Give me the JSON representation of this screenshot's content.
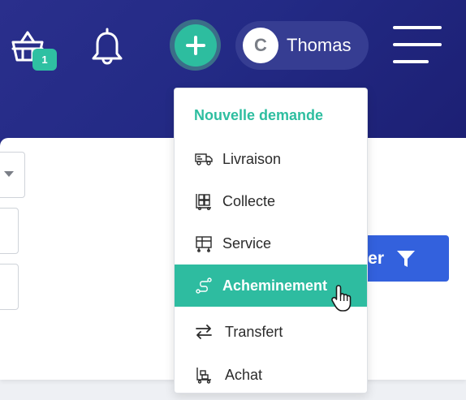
{
  "header": {
    "cart": {
      "icon": "shopping-basket-icon",
      "badge": "1",
      "badge_color": "#2fc0a2"
    },
    "notifications": {
      "icon": "bell-icon"
    },
    "new_request_button": {
      "icon": "plus-icon",
      "color": "#2dbd9f"
    },
    "user": {
      "initial": "C",
      "name": "Thomas"
    },
    "menu": {
      "icon": "hamburger-menu-icon"
    }
  },
  "filters": {
    "filter_button": {
      "label": "trer",
      "icon": "funnel-icon",
      "color": "#3361dd"
    }
  },
  "dropdown": {
    "title": "Nouvelle demande",
    "accent_color": "#2ebca0",
    "items": [
      {
        "label": "Livraison",
        "icon": "delivery-truck-icon",
        "active": false
      },
      {
        "label": "Collecte",
        "icon": "collection-cart-icon",
        "active": false
      },
      {
        "label": "Service",
        "icon": "service-cart-icon",
        "active": false
      },
      {
        "label": "Acheminement",
        "icon": "route-icon",
        "active": true
      },
      {
        "label": "Transfert",
        "icon": "transfer-arrows-icon",
        "active": false
      },
      {
        "label": "Achat",
        "icon": "purchase-trolley-icon",
        "active": false
      }
    ]
  }
}
